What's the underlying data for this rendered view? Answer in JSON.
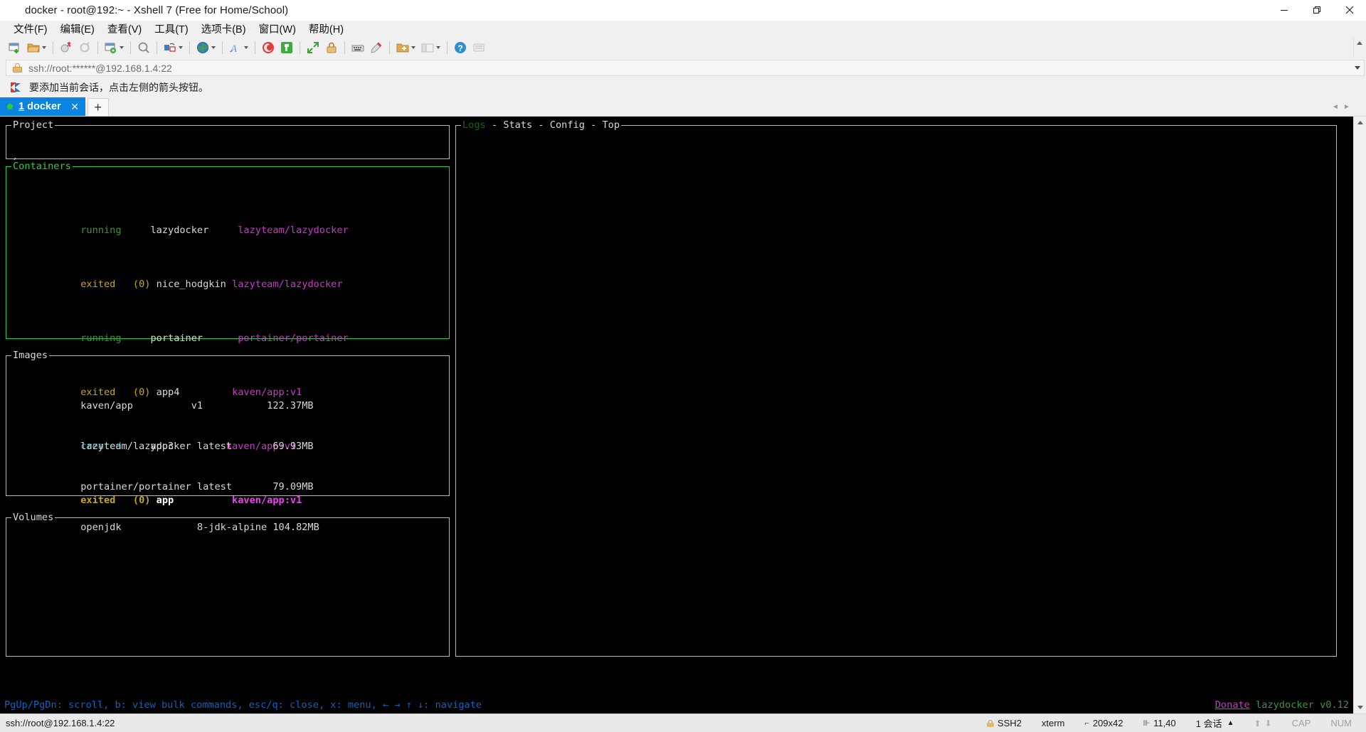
{
  "window": {
    "title": "docker - root@192:~ - Xshell 7 (Free for Home/School)",
    "app_icon": "xshell-logo-icon",
    "controls": {
      "minimize": "minimize-icon",
      "maximize": "maximize-icon",
      "close": "close-icon"
    }
  },
  "menubar": {
    "items": [
      {
        "label": "文件(F)",
        "name": "menu-file"
      },
      {
        "label": "编辑(E)",
        "name": "menu-edit"
      },
      {
        "label": "查看(V)",
        "name": "menu-view"
      },
      {
        "label": "工具(T)",
        "name": "menu-tools"
      },
      {
        "label": "选项卡(B)",
        "name": "menu-tabs"
      },
      {
        "label": "窗口(W)",
        "name": "menu-window"
      },
      {
        "label": "帮助(H)",
        "name": "menu-help"
      }
    ]
  },
  "toolbar": {
    "buttons": [
      "new-session-icon",
      "open-folder-icon",
      "disconnect-icon",
      "reconnect-icon",
      "new-file-transfer-icon",
      "find-icon",
      "layout-icon",
      "globe-icon",
      "font-icon",
      "xshell-icon",
      "xftp-icon",
      "fullscreen-icon",
      "lock-icon",
      "keyboard-icon",
      "highlight-icon",
      "folder-add-icon",
      "panes-icon",
      "help-icon",
      "notes-icon"
    ]
  },
  "urlbar": {
    "lock_icon": "lock-icon",
    "value": "ssh://root:******@192.168.1.4:22",
    "dropdown_icon": "chevron-down-icon"
  },
  "notice": {
    "icon": "flag-icon",
    "text": "要添加当前会话，点击左侧的箭头按钮。"
  },
  "tabs": {
    "active": {
      "status_dot": "green",
      "index": "1",
      "label": " docker",
      "close_icon": "close-icon"
    },
    "add_label": "+",
    "nav_prev": "◄",
    "nav_next": "►"
  },
  "terminal": {
    "panes": {
      "project": {
        "title": "Project",
        "lines": [
          "/"
        ]
      },
      "containers": {
        "title": "Containers",
        "active": true,
        "rows": [
          {
            "status": "running",
            "code": "",
            "name": "lazydocker",
            "image": "lazyteam/lazydocker",
            "status_color": "mgreen",
            "selected": false
          },
          {
            "status": "exited",
            "code": "(0)",
            "name": "nice_hodgkin",
            "image": "lazyteam/lazydocker",
            "status_color": "yellow",
            "selected": false
          },
          {
            "status": "running",
            "code": "",
            "name": "portainer",
            "image": "portainer/portainer",
            "status_color": "mgreen",
            "selected": false
          },
          {
            "status": "exited",
            "code": "(0)",
            "name": "app4",
            "image": "kaven/app:v1",
            "status_color": "yellow",
            "selected": false
          },
          {
            "status": "created",
            "code": "",
            "name": "app3",
            "image": "kaven/app:v1",
            "status_color": "cyan",
            "selected": false
          },
          {
            "status": "exited",
            "code": "(0)",
            "name": "app",
            "image": "kaven/app:v1",
            "status_color": "yellow",
            "selected": true
          }
        ]
      },
      "images": {
        "title": "Images",
        "rows": [
          {
            "repo": "kaven/app",
            "tag": "v1",
            "size": "122.37MB"
          },
          {
            "repo": "lazyteam/lazydocker",
            "tag": "latest",
            "size": "69.93MB"
          },
          {
            "repo": "portainer/portainer",
            "tag": "latest",
            "size": "79.09MB"
          },
          {
            "repo": "openjdk",
            "tag": "8-jdk-alpine",
            "size": "104.82MB"
          }
        ]
      },
      "volumes": {
        "title": "Volumes",
        "rows": []
      },
      "main": {
        "tabs": [
          {
            "label": "Logs",
            "active": false
          },
          {
            "label": "Stats",
            "active": true
          },
          {
            "label": "Config",
            "active": true
          },
          {
            "label": "Top",
            "active": true
          }
        ],
        "separator": " - ",
        "content": ""
      }
    },
    "statusline": {
      "help": "PgUp/PgDn: scroll, b: view bulk commands, esc/q: close, x: menu, ← → ↑ ↓: navigate",
      "donate": "Donate",
      "version": "lazydocker v0.12"
    }
  },
  "statusbar": {
    "connection": "ssh://root@192.168.1.4:22",
    "protocol": "SSH2",
    "terminal_type": "xterm",
    "size": "209x42",
    "cursor": "11,40",
    "sessions": "1 会话",
    "caps": "CAP",
    "num": "NUM",
    "size_icon": "resize-icon",
    "cursor_icon": "cursor-icon",
    "sessions_caret": "▲",
    "up_icon": "arrow-up-icon",
    "down_icon": "arrow-down-icon"
  },
  "colors": {
    "tab_active": "#0a84e0",
    "pane_active_border": "#2ecc40",
    "terminal_bg": "#000000",
    "status_running": "#3f9142",
    "status_exited": "#c7a718",
    "status_created": "#22b6c4",
    "image_text": "#c838c8",
    "help_text": "#1061c3"
  }
}
